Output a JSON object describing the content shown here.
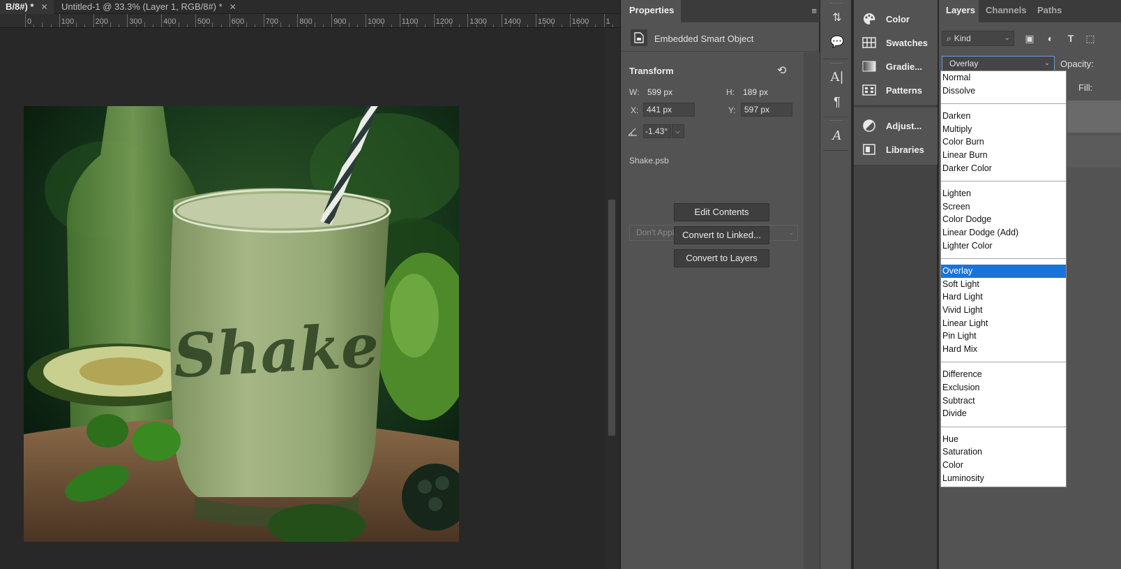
{
  "document_tabs": [
    {
      "label": "B/8#) *"
    },
    {
      "label": "Untitled-1 @ 33.3% (Layer 1, RGB/8#) *"
    }
  ],
  "ruler": {
    "labels": [
      "0",
      "100",
      "200",
      "300",
      "400",
      "500",
      "600",
      "700",
      "800",
      "900",
      "1000",
      "1100",
      "1200",
      "1300",
      "1400",
      "1500",
      "1600",
      "1"
    ]
  },
  "canvas": {
    "image_text": "Shake"
  },
  "properties": {
    "tab": "Properties",
    "object_type": "Embedded Smart Object",
    "section": "Transform",
    "w_label": "W:",
    "w_value": "599 px",
    "h_label": "H:",
    "h_value": "189 px",
    "x_label": "X:",
    "x_value": "441 px",
    "y_label": "Y:",
    "y_value": "597 px",
    "angle_value": "-1.43°",
    "file_name": "Shake.psb",
    "layer_comp_placeholder": "Don't Apply Layer Comp",
    "buttons": {
      "edit": "Edit Contents",
      "linked": "Convert to Linked...",
      "layers": "Convert to Layers"
    }
  },
  "mini_panels": [
    {
      "label": "Color",
      "icon": "palette-icon"
    },
    {
      "label": "Swatches",
      "icon": "swatches-grid-icon"
    },
    {
      "label": "Gradie...",
      "icon": "gradient-icon"
    },
    {
      "label": "Patterns",
      "icon": "patterns-icon"
    },
    {
      "label": "Adjust...",
      "icon": "adjustments-icon"
    },
    {
      "label": "Libraries",
      "icon": "libraries-icon"
    }
  ],
  "layers_panel": {
    "tabs": [
      "Layers",
      "Channels",
      "Paths"
    ],
    "filter_kind": "Kind",
    "blend_mode": "Overlay",
    "opacity_label": "Opacity:",
    "fill_label": "Fill:"
  },
  "blend_modes": [
    [
      "Normal",
      "Dissolve"
    ],
    [
      "Darken",
      "Multiply",
      "Color Burn",
      "Linear Burn",
      "Darker Color"
    ],
    [
      "Lighten",
      "Screen",
      "Color Dodge",
      "Linear Dodge (Add)",
      "Lighter Color"
    ],
    [
      "Overlay",
      "Soft Light",
      "Hard Light",
      "Vivid Light",
      "Linear Light",
      "Pin Light",
      "Hard Mix"
    ],
    [
      "Difference",
      "Exclusion",
      "Subtract",
      "Divide"
    ],
    [
      "Hue",
      "Saturation",
      "Color",
      "Luminosity"
    ]
  ],
  "selected_blend_mode": "Overlay",
  "colors": {
    "selection": "#1a73d8",
    "panel": "#535353",
    "canvas_bg": "#282828"
  }
}
